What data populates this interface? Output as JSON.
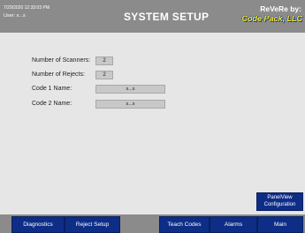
{
  "header": {
    "datetime": "7/29/2020 12:33:03 PM",
    "user": "User:  s...s",
    "title": "SYSTEM SETUP",
    "brand_line1": "ReVeRe by:",
    "brand_line2": "Code Pack, LLC"
  },
  "settings": {
    "scanners_label": "Number of Scanners:",
    "scanners_value": "2",
    "rejects_label": "Number of Rejects:",
    "rejects_value": "2",
    "code1_label": "Code 1 Name:",
    "code1_value": "s...s",
    "code2_label": "Code 2 Name:",
    "code2_value": "s...s"
  },
  "panelview_button": "PanelView Configuration",
  "nav": {
    "diagnostics": "Diagnostics",
    "reject_setup": "Reject Setup",
    "teach_codes": "Teach Codes",
    "alarms": "Alarms",
    "main": "Main"
  },
  "colors": {
    "header_bg": "#8b8b8b",
    "content_bg": "#e6e6e6",
    "button_blue": "#0e2d86",
    "brand_yellow": "#ffe633"
  }
}
